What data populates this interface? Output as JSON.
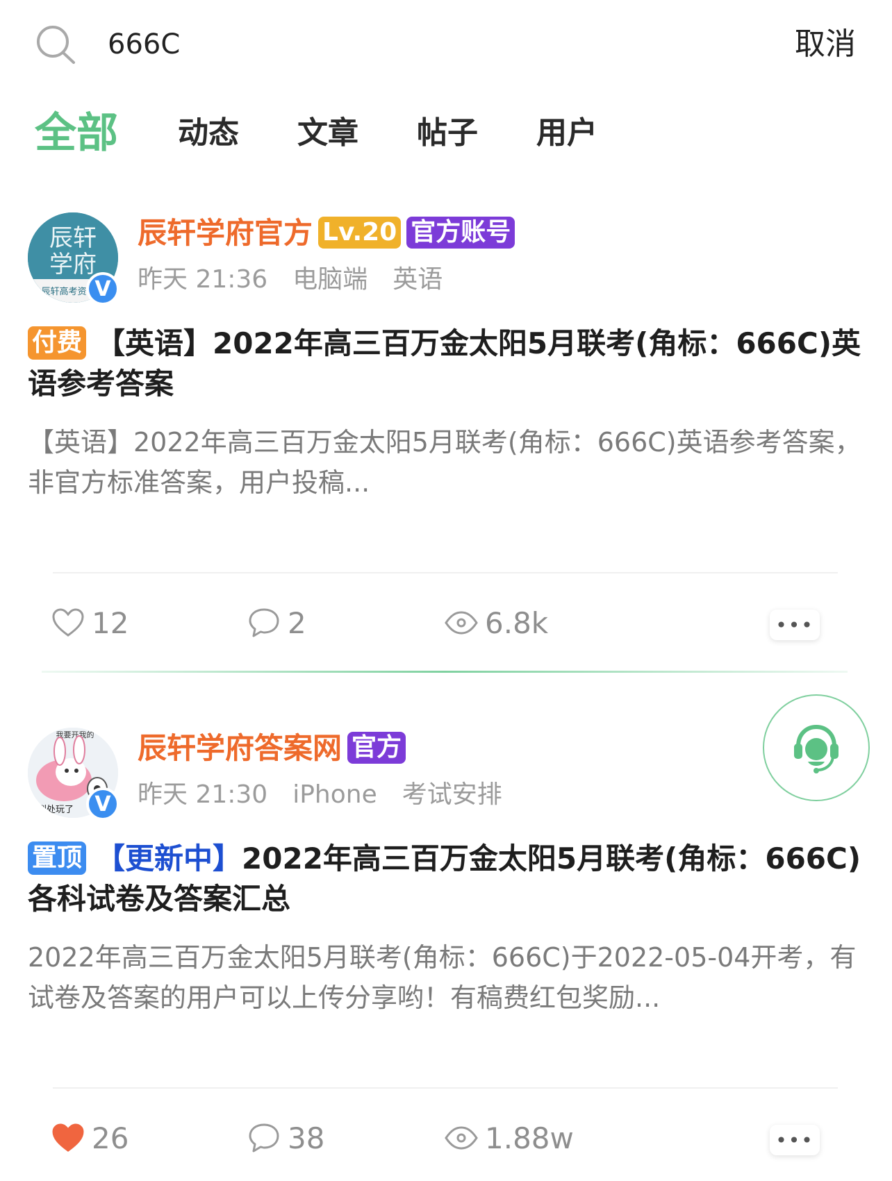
{
  "search": {
    "query": "666C",
    "cancel_label": "取消"
  },
  "tabs": [
    {
      "label": "全部",
      "active": true
    },
    {
      "label": "动态",
      "active": false
    },
    {
      "label": "文章",
      "active": false
    },
    {
      "label": "帖子",
      "active": false
    },
    {
      "label": "用户",
      "active": false
    }
  ],
  "posts": [
    {
      "author": "辰轩学府官方",
      "level_badge": "Lv.20",
      "account_badge": "官方账号",
      "avatar_text_1": "辰轩",
      "avatar_text_2": "学府",
      "avatar_caption": "辰轩高考资",
      "time": "昨天 21:36",
      "device": "电脑端",
      "category": "英语",
      "tag": "付费",
      "title_text": "【英语】2022年高三百万金太阳5月联考(角标：666C)英语参考答案",
      "excerpt": "【英语】2022年高三百万金太阳5月联考(角标：666C)英语参考答案，非官方标准答案，用户投稿...",
      "likes": "12",
      "liked": false,
      "comments": "2",
      "views": "6.8k",
      "more": "•••"
    },
    {
      "author": "辰轩学府答案网",
      "account_badge": "官方",
      "avatar_caption_top": "我要开我的",
      "avatar_caption_bottom": "到处玩了",
      "time": "昨天 21:30",
      "device": "iPhone",
      "category": "考试安排",
      "tag": "置顶",
      "title_highlight": "【更新中】",
      "title_text": "2022年高三百万金太阳5月联考(角标：666C)各科试卷及答案汇总",
      "excerpt": "2022年高三百万金太阳5月联考(角标：666C)于2022-05-04开考，有试卷及答案的用户可以上传分享哟！有稿费红包奖励...",
      "likes": "26",
      "liked": true,
      "comments": "38",
      "views": "1.88w",
      "more": "•••"
    }
  ],
  "verified_mark": "V",
  "colors": {
    "accent_green": "#5cc184",
    "author_orange": "#ee6a2b",
    "level_badge": "#f0b12a",
    "official_badge": "#7c3bd8",
    "paid_tag": "#f5952f",
    "pinned_tag": "#3c8cf0",
    "like_active": "#f0653f"
  },
  "icons": [
    "search-icon",
    "heart-icon",
    "comment-icon",
    "eye-icon",
    "more-icon",
    "customer-service-icon",
    "verified-icon"
  ]
}
